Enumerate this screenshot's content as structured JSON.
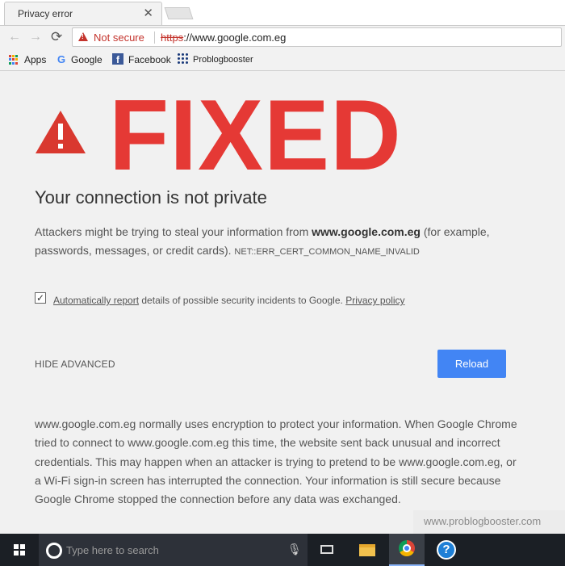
{
  "tab": {
    "title": "Privacy error",
    "close_glyph": "✕"
  },
  "nav": {
    "back_glyph": "←",
    "forward_glyph": "→",
    "reload_glyph": "⟳"
  },
  "omnibox": {
    "security_label": "Not secure",
    "url_scheme": "https",
    "url_rest": "://www.google.com.eg"
  },
  "bookmarks": [
    {
      "label": "Apps",
      "icon": "apps-grid-icon"
    },
    {
      "label": "Google",
      "icon": "google-g-icon"
    },
    {
      "label": "Facebook",
      "icon": "facebook-icon"
    },
    {
      "label": "Problogbooster",
      "icon": "problogbooster-icon"
    }
  ],
  "overlay": {
    "text": "FIXED",
    "color": "#e53935"
  },
  "page": {
    "heading": "Your connection is not private",
    "desc_1": "Attackers might be trying to steal your information from ",
    "desc_host": "www.google.com.eg",
    "desc_2": " (for example, passwords, messages, or credit cards). ",
    "error_code": "NET::ERR_CERT_COMMON_NAME_INVALID",
    "report_link": "Automatically report",
    "report_text": " details of possible security incidents to Google. ",
    "privacy_link": "Privacy policy",
    "report_checked": true,
    "hide_advanced": "HIDE ADVANCED",
    "reload": "Reload",
    "details": "www.google.com.eg normally uses encryption to protect your information. When Google Chrome tried to connect to www.google.com.eg this time, the website sent back unusual and incorrect credentials. This may happen when an attacker is trying to pretend to be www.google.com.eg, or a Wi-Fi sign-in screen has interrupted the connection. Your information is still secure because Google Chrome stopped the connection before any data was exchanged."
  },
  "watermark": "www.problogbooster.com",
  "taskbar": {
    "search_placeholder": "Type here to search",
    "help_glyph": "?"
  },
  "colors": {
    "accent": "#4285f4",
    "danger": "#c4342d"
  }
}
